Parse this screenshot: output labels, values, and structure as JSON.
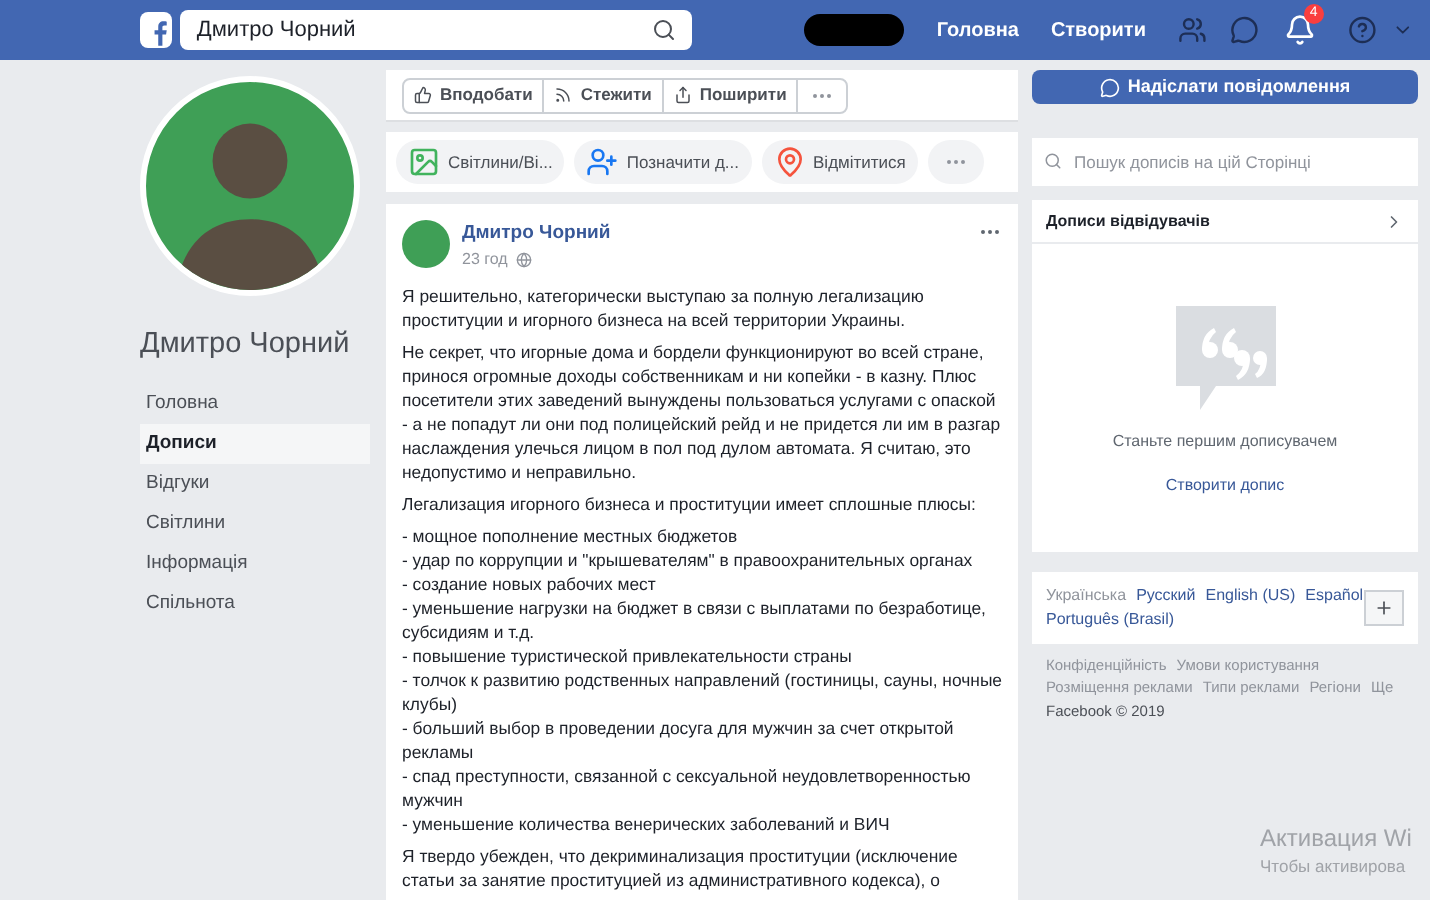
{
  "header": {
    "search_value": "Дмитро Чорний",
    "nav": [
      "Головна",
      "Створити"
    ],
    "notification_count": "4"
  },
  "profile": {
    "name": "Дмитро Чорний",
    "menu": [
      {
        "label": "Головна",
        "selected": false
      },
      {
        "label": "Дописи",
        "selected": true
      },
      {
        "label": "Відгуки",
        "selected": false
      },
      {
        "label": "Світлини",
        "selected": false
      },
      {
        "label": "Інформація",
        "selected": false
      },
      {
        "label": "Спільнота",
        "selected": false
      }
    ]
  },
  "page_actions": [
    "Вподобати",
    "Стежити",
    "Поширити"
  ],
  "message_button": "Надіслати повідомлення",
  "composer_actions": [
    {
      "kind": "photo",
      "label": "Світлини/Ві..."
    },
    {
      "kind": "tag",
      "label": "Позначити д..."
    },
    {
      "kind": "checkin",
      "label": "Відмітитися"
    }
  ],
  "post": {
    "author": "Дмитро Чорний",
    "time": "23 год",
    "paragraphs": [
      "Я решительно, категорически выступаю за полную легализацию проституции и игорного бизнеса на всей территории Украины.",
      "Не секрет, что игорные дома и бордели функционируют во всей стране, принося огромные доходы собственникам и ни копейки - в казну. Плюс посетители этих заведений вынуждены пользоваться услугами с опаской - а не попадут ли они под полицейский рейд и не придется ли им в разгар наслаждения улечься лицом в пол под дулом автомата. Я считаю, это недопустимо и неправильно.",
      "Легализация игорного бизнеса и проституции имеет сплошные плюсы:",
      "- мощное пополнение местных бюджетов\n- удар по коррупции и \"крышевателям\" в правоохранительных органах\n- создание новых рабочих мест\n- уменьшение нагрузки на бюджет в связи с выплатами по безработице, субсидиям и т.д.\n- повышение туристической привлекательности страны\n- толчок к развитию родственных направлений (гостиницы, сауны, ночные клубы)\n- больший выбор в проведении досуга для мужчин за счет открытой рекламы\n- спад преступности, связанной с сексуальной неудовлетворенностью мужчин\n- уменьшение количества венерических заболеваний и ВИЧ",
      "Я твердо убежден, что декриминализация проституции (исключение статьи за занятие проституцией из административного кодекса), о"
    ]
  },
  "sidebar": {
    "search_placeholder": "Пошук дописів на цій Сторінці",
    "visitor_posts": {
      "title": "Дописи відвідувачів",
      "empty_text": "Станьте першим дописувачем",
      "link": "Створити допис"
    },
    "languages": [
      {
        "label": "Українська",
        "selected": true
      },
      {
        "label": "Русский",
        "selected": false
      },
      {
        "label": "English (US)",
        "selected": false
      },
      {
        "label": "Español",
        "selected": false
      },
      {
        "label": "Português (Brasil)",
        "selected": false
      }
    ],
    "footer_links": [
      "Конфіденційність",
      "Умови користування",
      "Розміщення реклами",
      "Типи реклами",
      "Регіони",
      "Ще"
    ],
    "copyright": "Facebook © 2019"
  },
  "os_overlay": [
    "Активация Wi",
    "Чтобы активирова"
  ]
}
